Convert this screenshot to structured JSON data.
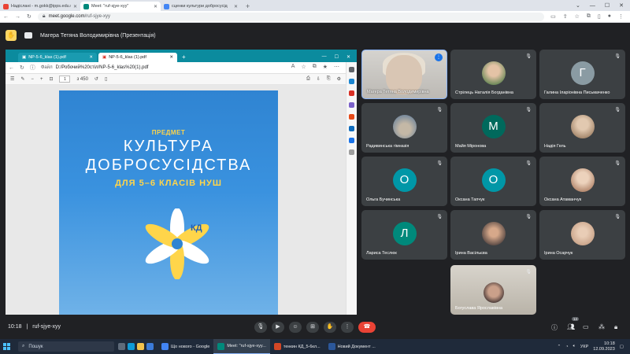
{
  "chrome": {
    "tabs": [
      {
        "label": "Надіслані - m.gokk@ipps.edu.u",
        "color": "#ea4335",
        "active": false
      },
      {
        "label": "Meet: \"ruf-sjye-xyy\"",
        "color": "#00897b",
        "active": true
      },
      {
        "label": "сценки культури добросусід",
        "color": "#4285f4",
        "active": false
      }
    ],
    "url_host": "meet.google.com",
    "url_path": "/ruf-sjye-xyy"
  },
  "presenter": {
    "label": "Магера Тетяна Володимирівна (Презентація)"
  },
  "shared_screen": {
    "edge_tabs": [
      "NP-5-6_klas (1).pdf",
      "NP-5-6_klas (1).pdf"
    ],
    "file_label": "Файл",
    "file_path": "D:/Робочий%20стіл/NP-5-6_klas%20(1).pdf",
    "page_current": "1",
    "page_total": "з 450",
    "document": {
      "subject": "ПРЕДМЕТ",
      "title_line1": "КУЛЬТУРА",
      "title_line2": "ДОБРОСУСІДСТВА",
      "grade": "ДЛЯ 5–6 КЛАСІВ НУШ",
      "logo_letters": "КД"
    }
  },
  "participants": [
    {
      "name": "Магера Тетяна Володимирівна",
      "type": "video"
    },
    {
      "name": "Стрілець Наталія Богданівна",
      "type": "photo",
      "color": "#6e8a5a"
    },
    {
      "name": "Галина Іларіонівна Письмаченко",
      "type": "letter",
      "letter": "Г",
      "color": "#8a9ba3"
    },
    {
      "name": "Радивинська гімназія",
      "type": "photo",
      "color": "#7a8b9c"
    },
    {
      "name": "Майя Міронова",
      "type": "letter",
      "letter": "М",
      "color": "#00695c"
    },
    {
      "name": "Надія Гель",
      "type": "photo",
      "color": "#a6896e"
    },
    {
      "name": "Ольга Бучинська",
      "type": "letter",
      "letter": "О",
      "color": "#0097a7"
    },
    {
      "name": "Оксана Тапчук",
      "type": "letter",
      "letter": "О",
      "color": "#0097a7"
    },
    {
      "name": "Оксана Атаманчук",
      "type": "photo",
      "color": "#b58a70"
    },
    {
      "name": "Лариса Теслюк",
      "type": "letter",
      "letter": "Л",
      "color": "#00897b"
    },
    {
      "name": "Ірина Васільєва",
      "type": "photo",
      "color": "#5a4a45"
    },
    {
      "name": "Ірина Осарчук",
      "type": "photo",
      "color": "#c9a48a"
    },
    {
      "name": "Богуслава Ярославівна",
      "type": "self"
    }
  ],
  "meeting": {
    "time": "10:18",
    "separator": "|",
    "code": "ruf-sjye-xyy",
    "people_count": "14"
  },
  "taskbar": {
    "search_placeholder": "Пошук",
    "apps": [
      {
        "label": "Що нового - Google",
        "color": "#4285f4",
        "active": false
      },
      {
        "label": "Meet: \"ruf-sjye-xyy...",
        "color": "#00897b",
        "active": true
      },
      {
        "label": "тенкин КД_5-6кл...",
        "color": "#d24726",
        "active": false
      },
      {
        "label": "Новий Документ ...",
        "color": "#2b579a",
        "active": false
      }
    ],
    "lang": "УКР",
    "time": "10:18",
    "date": "12.09.2023"
  }
}
